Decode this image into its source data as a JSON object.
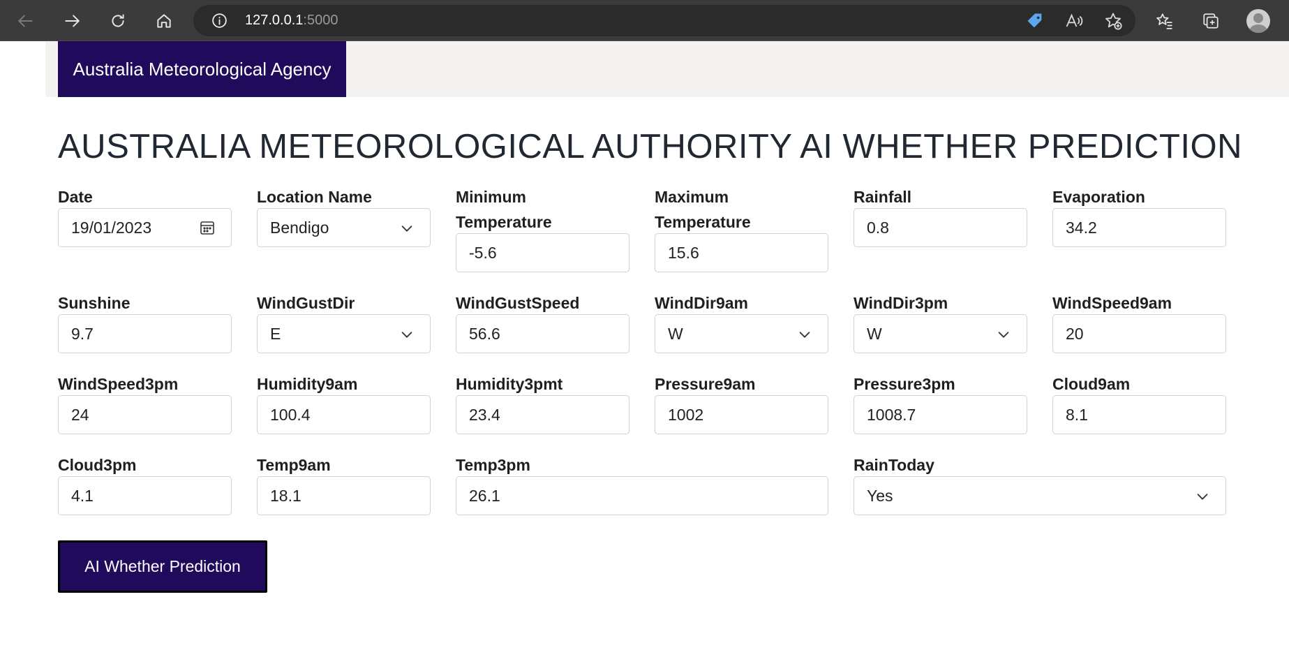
{
  "browser": {
    "url_host": "127.0.0.1",
    "url_port": ":5000"
  },
  "nav": {
    "brand": "Australia Meteorological Agency"
  },
  "page": {
    "title": "AUSTRALIA METEOROLOGICAL AUTHORITY AI WHETHER PREDICTION"
  },
  "form": {
    "date": {
      "label": "Date",
      "value": "19/01/2023"
    },
    "location": {
      "label": "Location Name",
      "value": "Bendigo"
    },
    "min_temp": {
      "label_1": "Minimum",
      "label_2": "Temperature",
      "value": "-5.6"
    },
    "max_temp": {
      "label_1": "Maximum",
      "label_2": "Temperature",
      "value": "15.6"
    },
    "rainfall": {
      "label": "Rainfall",
      "value": "0.8"
    },
    "evaporation": {
      "label": "Evaporation",
      "value": "34.2"
    },
    "sunshine": {
      "label": "Sunshine",
      "value": "9.7"
    },
    "wind_gust_dir": {
      "label": "WindGustDir",
      "value": "E"
    },
    "wind_gust_speed": {
      "label": "WindGustSpeed",
      "value": "56.6"
    },
    "wind_dir_9am": {
      "label": "WindDir9am",
      "value": "W"
    },
    "wind_dir_3pm": {
      "label": "WindDir3pm",
      "value": "W"
    },
    "wind_speed_9am": {
      "label": "WindSpeed9am",
      "value": "20"
    },
    "wind_speed_3pm": {
      "label": "WindSpeed3pm",
      "value": "24"
    },
    "humidity_9am": {
      "label": "Humidity9am",
      "value": "100.4"
    },
    "humidity_3pm": {
      "label": "Humidity3pmt",
      "value": "23.4"
    },
    "pressure_9am": {
      "label": "Pressure9am",
      "value": "1002"
    },
    "pressure_3pm": {
      "label": "Pressure3pm",
      "value": "1008.7"
    },
    "cloud_9am": {
      "label": "Cloud9am",
      "value": "8.1"
    },
    "cloud_3pm": {
      "label": "Cloud3pm",
      "value": "4.1"
    },
    "temp_9am": {
      "label": "Temp9am",
      "value": "18.1"
    },
    "temp_3pm": {
      "label": "Temp3pm",
      "value": "26.1"
    },
    "rain_today": {
      "label": "RainToday",
      "value": "Yes"
    },
    "submit_label": "AI Whether Prediction"
  },
  "colors": {
    "brand": "#1f0a5c",
    "chrome": "#3b3b3b"
  },
  "icons": [
    "back-icon",
    "forward-icon",
    "refresh-icon",
    "home-icon",
    "info-icon",
    "tag-icon",
    "read-aloud-icon",
    "add-favorite-icon",
    "favorites-icon",
    "collections-icon",
    "profile-avatar",
    "calendar-icon",
    "chevron-down-icon"
  ]
}
